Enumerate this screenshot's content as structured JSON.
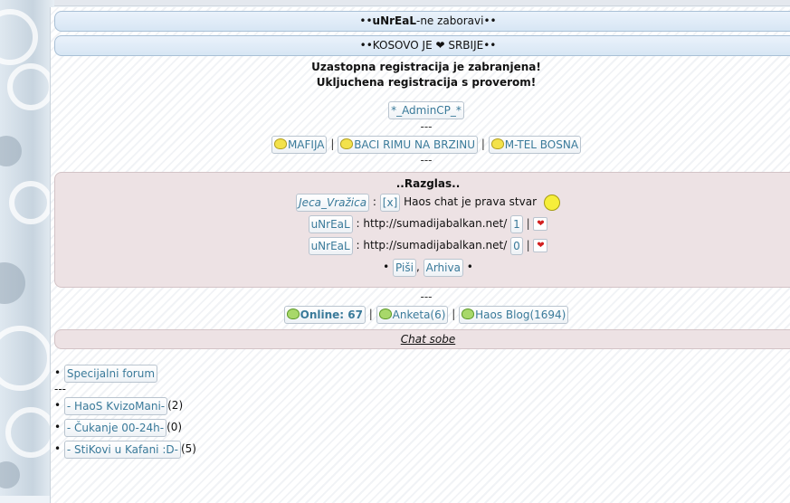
{
  "header": {
    "bar1": {
      "prefix": "••",
      "brand": "uNrEaL",
      "suffix": "-ne zaboravi••"
    },
    "bar2": "••KOSOVO JE ❤ SRBIJE••"
  },
  "notices": [
    "Uzastopna registracija je zabranjena!",
    "Ukljuchena registracija s proverom!"
  ],
  "admin_label": "*_AdminCP_*",
  "separator": "---",
  "pipe": "|",
  "links": [
    "MAFIJA",
    "BACI RIMU NA BRZINU",
    "M-TEL BOSNA"
  ],
  "razglas": {
    "title": "..Razglas..",
    "colon": ":",
    "entries": [
      {
        "user": "Jeca_Vražica",
        "count": "[x]",
        "message": "Haos chat je prava stvar"
      },
      {
        "user": "uNrEaL",
        "message": "http://sumadijabalkan.net/",
        "count": "1"
      },
      {
        "user": "uNrEaL",
        "message": "http://sumadijabalkan.net/",
        "count": "0"
      }
    ],
    "bullet": "•",
    "comma": ",",
    "actions": [
      "Piši",
      "Arhiva"
    ]
  },
  "stats": {
    "online": "Online: 67",
    "anketa": "Anketa(6)",
    "blog": "Haos Blog(1694)"
  },
  "chat_sobe": "Chat sobe",
  "forum": {
    "bullet": "•",
    "special": "Specijalni forum",
    "rooms": [
      {
        "name": "- HaoS KvizoMani-",
        "count": "(2)"
      },
      {
        "name": "- Čukanje 00-24h-",
        "count": "(0)"
      },
      {
        "name": "- StiKovi u Kafani :D-",
        "count": "(5)"
      }
    ]
  },
  "colors": {
    "link": "#3a7a9a",
    "bar_bg": "#dce9f6",
    "razglas_bg": "#ede2e4"
  }
}
